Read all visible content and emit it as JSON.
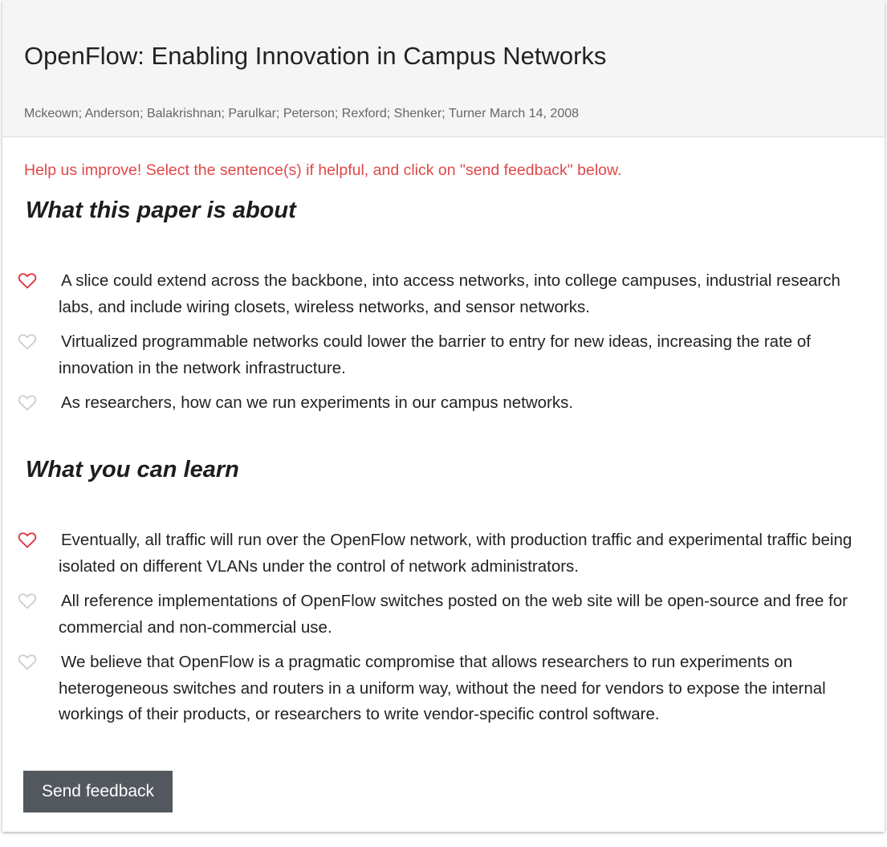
{
  "paper": {
    "title": "OpenFlow: Enabling Innovation in Campus Networks",
    "meta": "Mckeown; Anderson; Balakrishnan; Parulkar; Peterson; Rexford; Shenker; Turner March 14, 2008"
  },
  "notice": "Help us improve! Select the sentence(s) if helpful, and click on \"send feedback\" below.",
  "sections": [
    {
      "title": "What this paper is about",
      "items": [
        {
          "text": "A slice could extend across the backbone, into access networks, into college campuses, industrial research labs, and include wiring closets, wireless networks, and sensor networks.",
          "liked": true
        },
        {
          "text": "Virtualized programmable networks could lower the barrier to entry for new ideas, increasing the rate of innovation in the network infrastructure.",
          "liked": false
        },
        {
          "text": "As researchers, how can we run experiments in our campus networks.",
          "liked": false
        }
      ]
    },
    {
      "title": "What you can learn",
      "items": [
        {
          "text": "Eventually, all traffic will run over the OpenFlow network, with production traffic and experimental traffic being isolated on different VLANs under the control of network administrators.",
          "liked": true
        },
        {
          "text": "All reference implementations of OpenFlow switches posted on the web site will be open-source and free for commercial and non-commercial use.",
          "liked": false
        },
        {
          "text": "We believe that OpenFlow is a pragmatic compromise that allows researchers to run experiments on heterogeneous switches and routers in a uniform way, without the need for vendors to expose the internal workings of their products, or researchers to write vendor-specific control software.",
          "liked": false
        }
      ]
    }
  ],
  "send_button_label": "Send feedback",
  "icons": {
    "heart": "heart-icon"
  },
  "colors": {
    "heart_selected": "#e0343f",
    "heart_unselected": "#cfcfcf",
    "notice": "#e04848",
    "button_bg": "#52585e"
  }
}
